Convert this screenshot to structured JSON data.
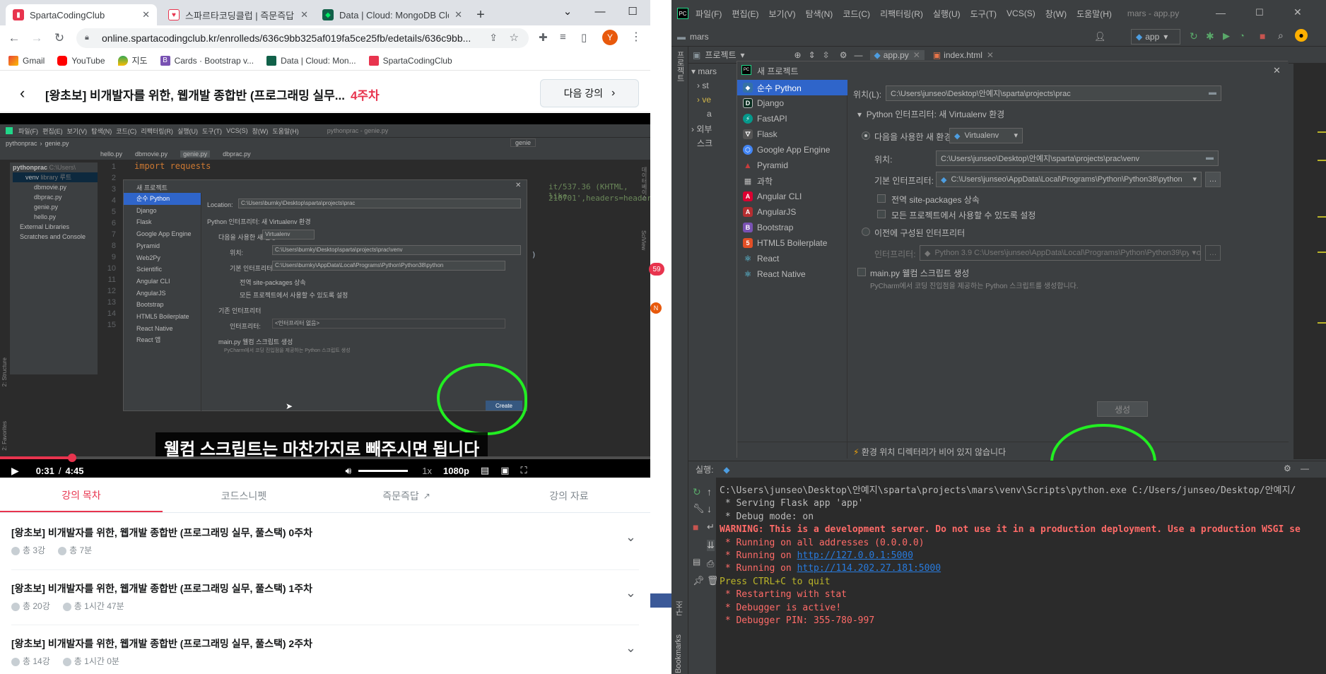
{
  "chrome": {
    "tabs": [
      {
        "title": "SpartaCodingClub",
        "active": true
      },
      {
        "title": "스파르타코딩클럽 | 즉문즉답",
        "active": false
      },
      {
        "title": "Data | Cloud: MongoDB Cloud",
        "active": false
      }
    ],
    "new_tab": "+",
    "url": "online.spartacodingclub.kr/enrolleds/636c9bb325af019fa5ce25fb/edetails/636c9bb...",
    "profile_initial": "Y",
    "bookmarks": [
      "Gmail",
      "YouTube",
      "지도",
      "Cards · Bootstrap v...",
      "Data | Cloud: Mon...",
      "SpartaCodingClub"
    ]
  },
  "lecture": {
    "title": "[왕초보] 비개발자를 위한, 웹개발 종합반 (프로그래밍 실무...",
    "week": "4주차",
    "next_label": "다음 강의"
  },
  "video": {
    "subtitle": "웰컴 스크립트는 마찬가지로 빼주시면 됩니다",
    "current_time": "0:31",
    "sep": "/",
    "duration": "4:45",
    "speed": "1x",
    "quality": "1080p",
    "progress": 0.109,
    "ide": {
      "menus": [
        "파일(F)",
        "편집(E)",
        "보기(V)",
        "탐색(N)",
        "코드(C)",
        "리팩터링(R)",
        "실행(U)",
        "도구(T)",
        "VCS(S)",
        "창(W)",
        "도움말(H)"
      ],
      "window_title": "pythonprac - genie.py",
      "breadcrumb": [
        "pythonprac",
        "genie.py"
      ],
      "run_config": "genie",
      "files": [
        "hello.py",
        "dbmovie.py",
        "genie.py",
        "dbprac.py"
      ],
      "tree": [
        "pythonprac",
        "venv",
        "dbmovie.py",
        "dbprac.py",
        "genie.py",
        "hello.py",
        "External Libraries",
        "Scratches and Console"
      ],
      "tree_root_path": "C:\\Users\\",
      "tree_venv_tag": "library 루트",
      "line_numbers": [
        "1",
        "2",
        "3",
        "4",
        "5",
        "6",
        "7",
        "8",
        "9",
        "10",
        "11",
        "12",
        "13",
        "14",
        "15"
      ],
      "code_line1": "import requests",
      "code_frag1": "it/537.36 (KHTML, like",
      "code_frag2": "210701',headers=header",
      "code_frag3": ")",
      "dialog_title": "새 프로젝트",
      "types": [
        "순수 Python",
        "Django",
        "Flask",
        "Google App Engine",
        "Pyramid",
        "Web2Py",
        "Scientific",
        "Angular CLI",
        "AngularJS",
        "Bootstrap",
        "HTML5 Boilerplate",
        "React Native",
        "React 앱"
      ],
      "location_label": "Location:",
      "location_value": "C:\\Users\\burnky\\Desktop\\sparta\\projects\\prac",
      "interp_section": "Python 인터프리터: 새 Virtualenv 환경",
      "new_env": "다음을 사용한 새 환경",
      "env_type": "Virtualenv",
      "venv_label": "위치:",
      "venv_path": "C:\\Users\\burnky\\Desktop\\sparta\\projects\\prac\\venv",
      "base_label": "기본 인터프리터:",
      "base_value": "C:\\Users\\burnky\\AppData\\Local\\Programs\\Python\\Python38\\python",
      "inherit": "전역 site-packages 상속",
      "avail_all": "모든 프로젝트에서 사용할 수 있도록 설정",
      "existing": "기존 인터프리터",
      "interp_label": "인터프리터:",
      "interp_value": "<인터프리터 없음>",
      "welcome": "main.py 웰컴 스크립트 생성",
      "welcome_desc": "PyCharm에서 코딩 진입점을 제공하는 Python 스크립트 생성",
      "create": "Create",
      "side_labels": [
        "2: Structure",
        "2: Favorites",
        "SciView",
        "데이터베이스"
      ]
    }
  },
  "lecture_tabs": [
    {
      "label": "강의 목차",
      "active": true
    },
    {
      "label": "코드스니펫",
      "active": false
    },
    {
      "label": "즉문즉답",
      "active": false,
      "external": true
    },
    {
      "label": "강의 자료",
      "active": false
    }
  ],
  "weeks": [
    {
      "title": "[왕초보] 비개발자를 위한, 웹개발 종합반 (프로그래밍 실무, 풀스택) 0주차",
      "lessons": "총 3강",
      "time": "총 7분"
    },
    {
      "title": "[왕초보] 비개발자를 위한, 웹개발 종합반 (프로그래밍 실무, 풀스택) 1주차",
      "lessons": "총 20강",
      "time": "총 1시간 47분"
    },
    {
      "title": "[왕초보] 비개발자를 위한, 웹개발 종합반 (프로그래밍 실무, 풀스택) 2주차",
      "lessons": "총 14강",
      "time": "총 1시간 0분"
    }
  ],
  "pycharm": {
    "menus": [
      "파일(F)",
      "편집(E)",
      "보기(V)",
      "탐색(N)",
      "코드(C)",
      "리팩터링(R)",
      "실행(U)",
      "도구(T)",
      "VCS(S)",
      "창(W)",
      "도움말(H)"
    ],
    "window_title": "mars - app.py",
    "project_name": "mars",
    "run_config": "app",
    "project_tab": "프로젝트",
    "file_tabs": [
      "app.py",
      "index.html"
    ],
    "tree_items": [
      "mars",
      "st",
      "ve",
      "a",
      "외부",
      "스크"
    ],
    "left_strip": [
      "프로젝트",
      "구조",
      "Bookmarks"
    ],
    "badges": [
      "59",
      "N"
    ],
    "dialog": {
      "title": "새 프로젝트",
      "types": [
        "순수 Python",
        "Django",
        "FastAPI",
        "Flask",
        "Google App Engine",
        "Pyramid",
        "과학",
        "Angular CLI",
        "AngularJS",
        "Bootstrap",
        "HTML5 Boilerplate",
        "React",
        "React Native"
      ],
      "location_label": "위치(L):",
      "location_value": "C:\\Users\\junseo\\Desktop\\안예지\\sparta\\projects\\prac",
      "interp_section": "Python 인터프리터: 새 Virtualenv 환경",
      "new_env": "다음을 사용한 새 환경",
      "env_type": "Virtualenv",
      "venv_label": "위치:",
      "venv_path": "C:\\Users\\junseo\\Desktop\\안예지\\sparta\\projects\\prac\\venv",
      "base_label": "기본 인터프리터:",
      "base_value": "C:\\Users\\junseo\\AppData\\Local\\Programs\\Python\\Python38\\python",
      "inherit": "전역 site-packages 상속",
      "avail_all": "모든 프로젝트에서 사용할 수 있도록 설정",
      "existing": "이전에 구성된 인터프리터",
      "interp_label": "인터프리터:",
      "interp_value": "Python 3.9 C:\\Users\\junseo\\AppData\\Local\\Programs\\Python\\Python39\\python",
      "welcome": "main.py 웰컴 스크립트 생성",
      "welcome_desc": "PyCharm에서 코딩 진입점을 제공하는 Python 스크립트를 생성합니다.",
      "warning": "환경 위치 디렉터리가 비어 있지 않습니다",
      "create": "생성"
    },
    "run_label": "실행:",
    "console": [
      {
        "text": "C:\\Users\\junseo\\Desktop\\안예지\\sparta\\projects\\mars\\venv\\Scripts\\python.exe C:/Users/junseo/Desktop/안예지/",
        "cls": "c-norm"
      },
      {
        "text": " * Serving Flask app 'app'",
        "cls": "c-norm"
      },
      {
        "text": " * Debug mode: on",
        "cls": "c-norm"
      },
      {
        "text": "WARNING: This is a development server. Do not use it in a production deployment. Use a production WSGI se",
        "cls": "c-warn"
      },
      {
        "text": " * Running on all addresses (0.0.0.0)",
        "cls": "c-red"
      },
      {
        "text": " * Running on ",
        "cls": "c-red",
        "link": "http://127.0.0.1:5000"
      },
      {
        "text": " * Running on ",
        "cls": "c-red",
        "link": "http://114.202.27.181:5000"
      },
      {
        "text": "Press CTRL+C to quit",
        "cls": "c-yel"
      },
      {
        "text": " * Restarting with stat",
        "cls": "c-red"
      },
      {
        "text": " * Debugger is active!",
        "cls": "c-red"
      },
      {
        "text": " * Debugger PIN: 355-780-997",
        "cls": "c-red"
      }
    ]
  },
  "colors": {
    "accent": "#e8344e",
    "py_select": "#2f65ca",
    "highlight_circle": "#22ee22"
  }
}
